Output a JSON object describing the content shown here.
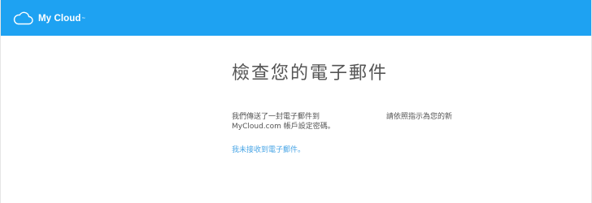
{
  "header": {
    "logo_icon": "cloud-icon",
    "brand": "My Cloud",
    "trademark": "™",
    "color": "#1ea2f2"
  },
  "main": {
    "title": "檢查您的電子郵件",
    "message_line1_part1": "我們傳送了一封電子郵件到",
    "message_line1_part2": "請依照指示為您的新",
    "message_line2": "MyCloud.com 帳戶設定密碼。",
    "resend_link": "我未接收到電子郵件。",
    "link_color": "#4aa6e6"
  }
}
